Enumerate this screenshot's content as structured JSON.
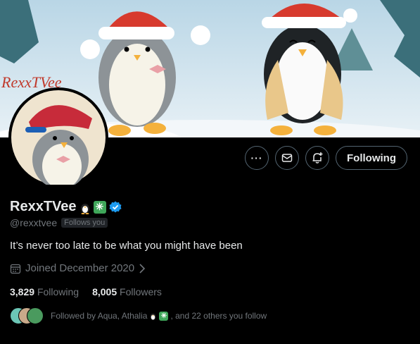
{
  "banner": {
    "watermark": "RexxTVee"
  },
  "actions": {
    "more_label": "···",
    "following_label": "Following"
  },
  "profile": {
    "display_name": "RexxTVee",
    "handle": "@rexxtvee",
    "follows_you_badge": "Follows you",
    "bio": "It’s never too late to be what you might have been",
    "joined": "Joined December 2020",
    "following_count": "3,829",
    "following_label": "Following",
    "followers_count": "8,005",
    "followers_label": "Followers",
    "followed_by_prefix": "Followed by Aqua, Athalia",
    "followed_by_suffix": ", and 22 others you follow"
  },
  "colors": {
    "verified": "#1d9bf0",
    "badge_green": "#3fa75a",
    "border": "#536471",
    "muted": "#71767b"
  },
  "icons": [
    "more-icon",
    "message-icon",
    "notify-bell-icon",
    "calendar-icon",
    "chevron-right-icon",
    "verified-badge-icon",
    "penguin-emoji-icon",
    "sparkle-emoji-icon"
  ]
}
